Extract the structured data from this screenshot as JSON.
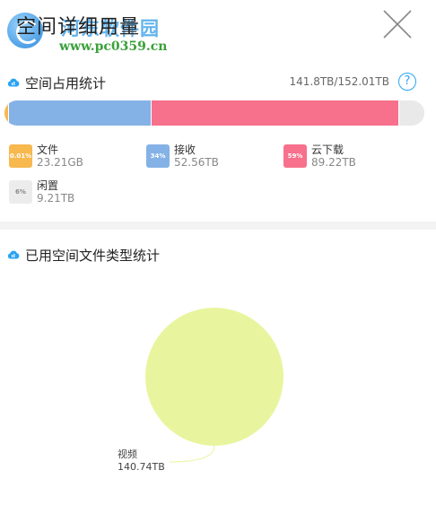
{
  "window": {
    "title": "空间详细用量",
    "watermark_text": "河东软件园",
    "watermark_url": "www.pc0359.cn"
  },
  "icons": {
    "close": "close-icon",
    "cloud": "cloud-icon",
    "help": "help-icon"
  },
  "usage_section": {
    "title": "空间占用统计",
    "summary": "141.8TB/152.01TB",
    "help_label": "?"
  },
  "usage_legend": [
    {
      "name": "文件",
      "value": "23.21GB",
      "percent": "0.01%",
      "fraction": 0.0001,
      "color": "#f7b84e"
    },
    {
      "name": "接收",
      "value": "52.56TB",
      "percent": "34%",
      "fraction": 0.34,
      "color": "#85b2e6"
    },
    {
      "name": "云下载",
      "value": "89.22TB",
      "percent": "59%",
      "fraction": 0.59,
      "color": "#f7708c"
    },
    {
      "name": "闲置",
      "value": "9.21TB",
      "percent": "6%",
      "fraction": 0.06,
      "color": "#e9e9e9"
    }
  ],
  "type_section": {
    "title": "已用空间文件类型统计"
  },
  "chart_data": {
    "type": "pie",
    "slices": [
      {
        "label": "视频",
        "value": 140.74,
        "display": "140.74TB",
        "color": "#e8f59e"
      }
    ]
  }
}
